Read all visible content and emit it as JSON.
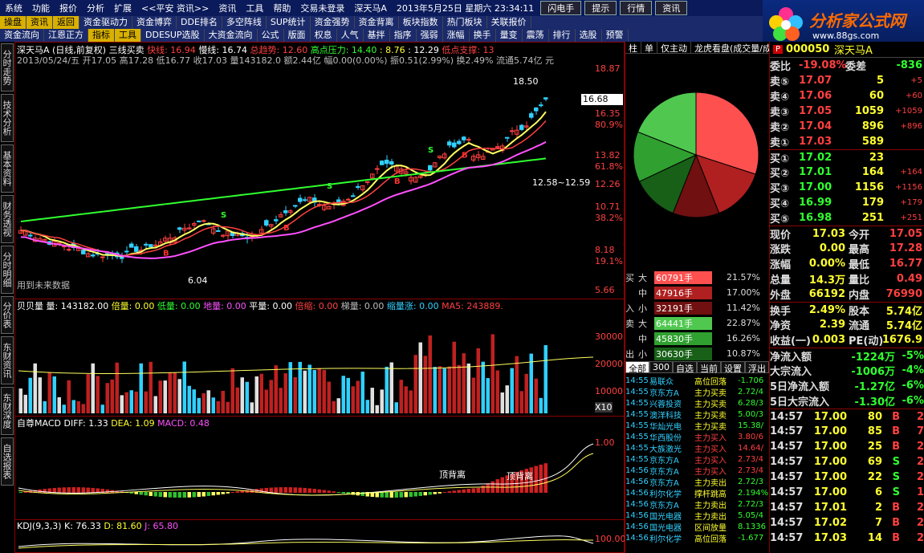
{
  "menu": [
    "系统",
    "功能",
    "报价",
    "分析",
    "扩展",
    "<<平安 资讯>>",
    "资讯",
    "工具",
    "帮助",
    "交易未登录",
    "深天马A",
    "2013年5月25日 星期六 23:34:11",
    "闪电手",
    "提示",
    "行情",
    "资讯"
  ],
  "tabs1": [
    "操盘",
    "资讯",
    "返回",
    "资金驱动力",
    "资金博弈",
    "DDE排名",
    "多空阵线",
    "SUP统计",
    "资金强势",
    "资金背离",
    "板块指数",
    "热门板块",
    "关联报价"
  ],
  "tabs2": [
    "资金流向",
    "江恩正方",
    "指标",
    "工具",
    "DDESUP选股",
    "大资金流向",
    "公式",
    "版面",
    "权息",
    "人气",
    "基拌",
    "指序",
    "强弱",
    "涨幅",
    "换手",
    "量变",
    "震荡",
    "排行",
    "选股",
    "预警"
  ],
  "logo": {
    "title": "分析家公式网",
    "url": "www.88gs.com"
  },
  "vtabs": [
    "分时走势",
    "技术分析",
    "基本资料",
    "财务透视",
    "分时明细",
    "分价表",
    "东财资讯",
    "东财深度",
    "自选报表"
  ],
  "main": {
    "title": "深天马A (日线,前复权) 三线买卖",
    "fast": "快线: 16.94",
    "slow": "慢线: 16.74",
    "trend": "总趋势: 12.60",
    "resist": "高点压力: 14.40",
    "v1": ": 8.76",
    "v2": ": 12.29",
    "support": "低点支撑: 13",
    "ohlc": "2013/05/24/五 开17.05 高17.28 低16.77 收17.03 量143182.0 额2.44亿 幅0.00(0.00%) 振0.51(2.99%) 换2.49% 流通5.74亿 元",
    "future_note": "用到未来数据",
    "peak_label": "18.50",
    "low_label": "6.04",
    "range_label": "12.58~12.59",
    "price_axis": [
      "18.87",
      "16.68",
      "16.35",
      "80.9%",
      "13.82",
      "61.8%",
      "12.26",
      "10.71",
      "38.2%",
      "8.18",
      "19.1%",
      "5.66"
    ],
    "vol_hdr": [
      "贝贝量",
      "量: 143182.00",
      "倍量: 0.00",
      "低量: 0.00",
      "地量: 0.00",
      "平量: 0.00",
      "倍缩: 0.00",
      "梯量: 0.00",
      "缩量涨: 0.00",
      "MA5: 243889."
    ],
    "vol_axis": [
      "30000",
      "20000",
      "10000",
      "X10"
    ],
    "macd_hdr": [
      "自尊MACD",
      "DIFF: 1.33",
      "DEA: 1.09",
      "MACD: 0.48"
    ],
    "macd_axis": [
      "1.00",
      "0.00"
    ],
    "macd_notes": [
      "顶背离",
      "顶背离"
    ],
    "kdj_hdr": [
      "KDJ(9,3,3)",
      "K: 76.33",
      "D: 81.60",
      "J: 65.80"
    ],
    "kdj_axis": [
      "100.00",
      "80.00"
    ]
  },
  "flowtabs": [
    "柱",
    "单",
    "仅主动",
    "龙虎看盘(成交量/成"
  ],
  "pie": [
    {
      "p": 0.3,
      "c": "#ff5050"
    },
    {
      "p": 0.14,
      "c": "#b02020"
    },
    {
      "p": 0.12,
      "c": "#701010"
    },
    {
      "p": 0.12,
      "c": "#186018"
    },
    {
      "p": 0.13,
      "c": "#30a030"
    },
    {
      "p": 0.19,
      "c": "#50c850"
    }
  ],
  "buy_sell": {
    "buy_label": "买入",
    "sell_label": "卖出",
    "rows": [
      {
        "k": "大",
        "v": "60791手",
        "pct": "21.57%",
        "c": "#ff5050"
      },
      {
        "k": "中",
        "v": "47916手",
        "pct": "17.00%",
        "c": "#b02020"
      },
      {
        "k": "小",
        "v": "32191手",
        "pct": "11.42%",
        "c": "#701010"
      },
      {
        "k": "大",
        "v": "64441手",
        "pct": "22.87%",
        "c": "#50c850"
      },
      {
        "k": "中",
        "v": "45830手",
        "pct": "16.26%",
        "c": "#30a030"
      },
      {
        "k": "小",
        "v": "30630手",
        "pct": "10.87%",
        "c": "#186018"
      }
    ]
  },
  "list_tabs": [
    "全部",
    "300",
    "自选",
    "当前",
    "设置",
    "浮出"
  ],
  "list": [
    [
      "14:55",
      "易联众",
      "高位回落",
      "-1.706"
    ],
    [
      "14:55",
      "京东方A",
      "主力买卖",
      "2.72/4"
    ],
    [
      "14:55",
      "兴蓉投资",
      "主力买卖",
      "6.28/3"
    ],
    [
      "14:55",
      "澳洋科技",
      "主力买卖",
      "5.00/3"
    ],
    [
      "14:55",
      "华灿光电",
      "主力买卖",
      "15.38/"
    ],
    [
      "14:55",
      "华西股份",
      "主力买入",
      "3.80/6"
    ],
    [
      "14:55",
      "大族激光",
      "主力买入",
      "14.64/"
    ],
    [
      "14:55",
      "京东方A",
      "主力买入",
      "2.73/4"
    ],
    [
      "14:56",
      "京东方A",
      "主力买入",
      "2.73/4"
    ],
    [
      "14:56",
      "京东方A",
      "主力卖出",
      "2.72/3"
    ],
    [
      "14:56",
      "利尔化学",
      "撑杆跳高",
      "2.194%"
    ],
    [
      "14:56",
      "京东方A",
      "主力卖出",
      "2.72/3"
    ],
    [
      "14:56",
      "国光电器",
      "主力卖出",
      "5.05/4"
    ],
    [
      "14:56",
      "国光电器",
      "区间放量",
      "8.1336"
    ],
    [
      "14:56",
      "利尔化学",
      "高位回落",
      "-1.677"
    ]
  ],
  "quote": {
    "code": "000050",
    "name": "深天马A",
    "wei": [
      "委比",
      "-19.08%",
      "委差",
      "-836"
    ],
    "asks": [
      [
        "卖⑤",
        "17.07",
        "5",
        "+5"
      ],
      [
        "卖④",
        "17.06",
        "60",
        "+60"
      ],
      [
        "卖③",
        "17.05",
        "1059",
        "+1059"
      ],
      [
        "卖②",
        "17.04",
        "896",
        "+896"
      ],
      [
        "卖①",
        "17.03",
        "589",
        ""
      ]
    ],
    "bids": [
      [
        "买①",
        "17.02",
        "23",
        ""
      ],
      [
        "买②",
        "17.01",
        "164",
        "+164"
      ],
      [
        "买③",
        "17.00",
        "1156",
        "+1156"
      ],
      [
        "买④",
        "16.99",
        "179",
        "+179"
      ],
      [
        "买⑤",
        "16.98",
        "251",
        "+251"
      ]
    ],
    "stats": [
      [
        "现价",
        "17.03",
        "今开",
        "17.05"
      ],
      [
        "涨跌",
        "0.00",
        "最高",
        "17.28"
      ],
      [
        "涨幅",
        "0.00%",
        "最低",
        "16.77"
      ],
      [
        "总量",
        "14.3万",
        "量比",
        "0.49"
      ],
      [
        "外盘",
        "66192",
        "内盘",
        "76990"
      ]
    ],
    "stats2": [
      [
        "换手",
        "2.49%",
        "股本",
        "5.74亿"
      ],
      [
        "净资",
        "2.39",
        "流通",
        "5.74亿"
      ],
      [
        "收益(一)",
        "0.003",
        "PE(动)",
        "1676.9"
      ]
    ],
    "flow": [
      [
        "净流入额",
        "-1224万",
        "-5%"
      ],
      [
        "大宗流入",
        "-1006万",
        "-4%"
      ],
      [
        "5日净流入额",
        "-1.27亿",
        "-6%"
      ],
      [
        "5日大宗流入",
        "-1.30亿",
        "-6%"
      ]
    ],
    "ticks": [
      [
        "14:57",
        "17.00",
        "80",
        "B",
        "2"
      ],
      [
        "14:57",
        "17.00",
        "85",
        "B",
        "7"
      ],
      [
        "14:57",
        "17.00",
        "25",
        "B",
        "2"
      ],
      [
        "14:57",
        "17.00",
        "69",
        "S",
        "2"
      ],
      [
        "14:57",
        "17.00",
        "22",
        "S",
        "2"
      ],
      [
        "14:57",
        "17.00",
        "6",
        "S",
        "1"
      ],
      [
        "14:57",
        "17.01",
        "2",
        "B",
        "2"
      ],
      [
        "14:57",
        "17.02",
        "7",
        "B",
        "2"
      ],
      [
        "14:57",
        "17.03",
        "14",
        "B",
        "2"
      ]
    ]
  },
  "colors": {
    "up": "#ff4040",
    "down": "#30d0ff",
    "fast": "#ffff60",
    "slow": "#ff4040",
    "trend": "#30ff30",
    "support": "#ff50ff"
  }
}
